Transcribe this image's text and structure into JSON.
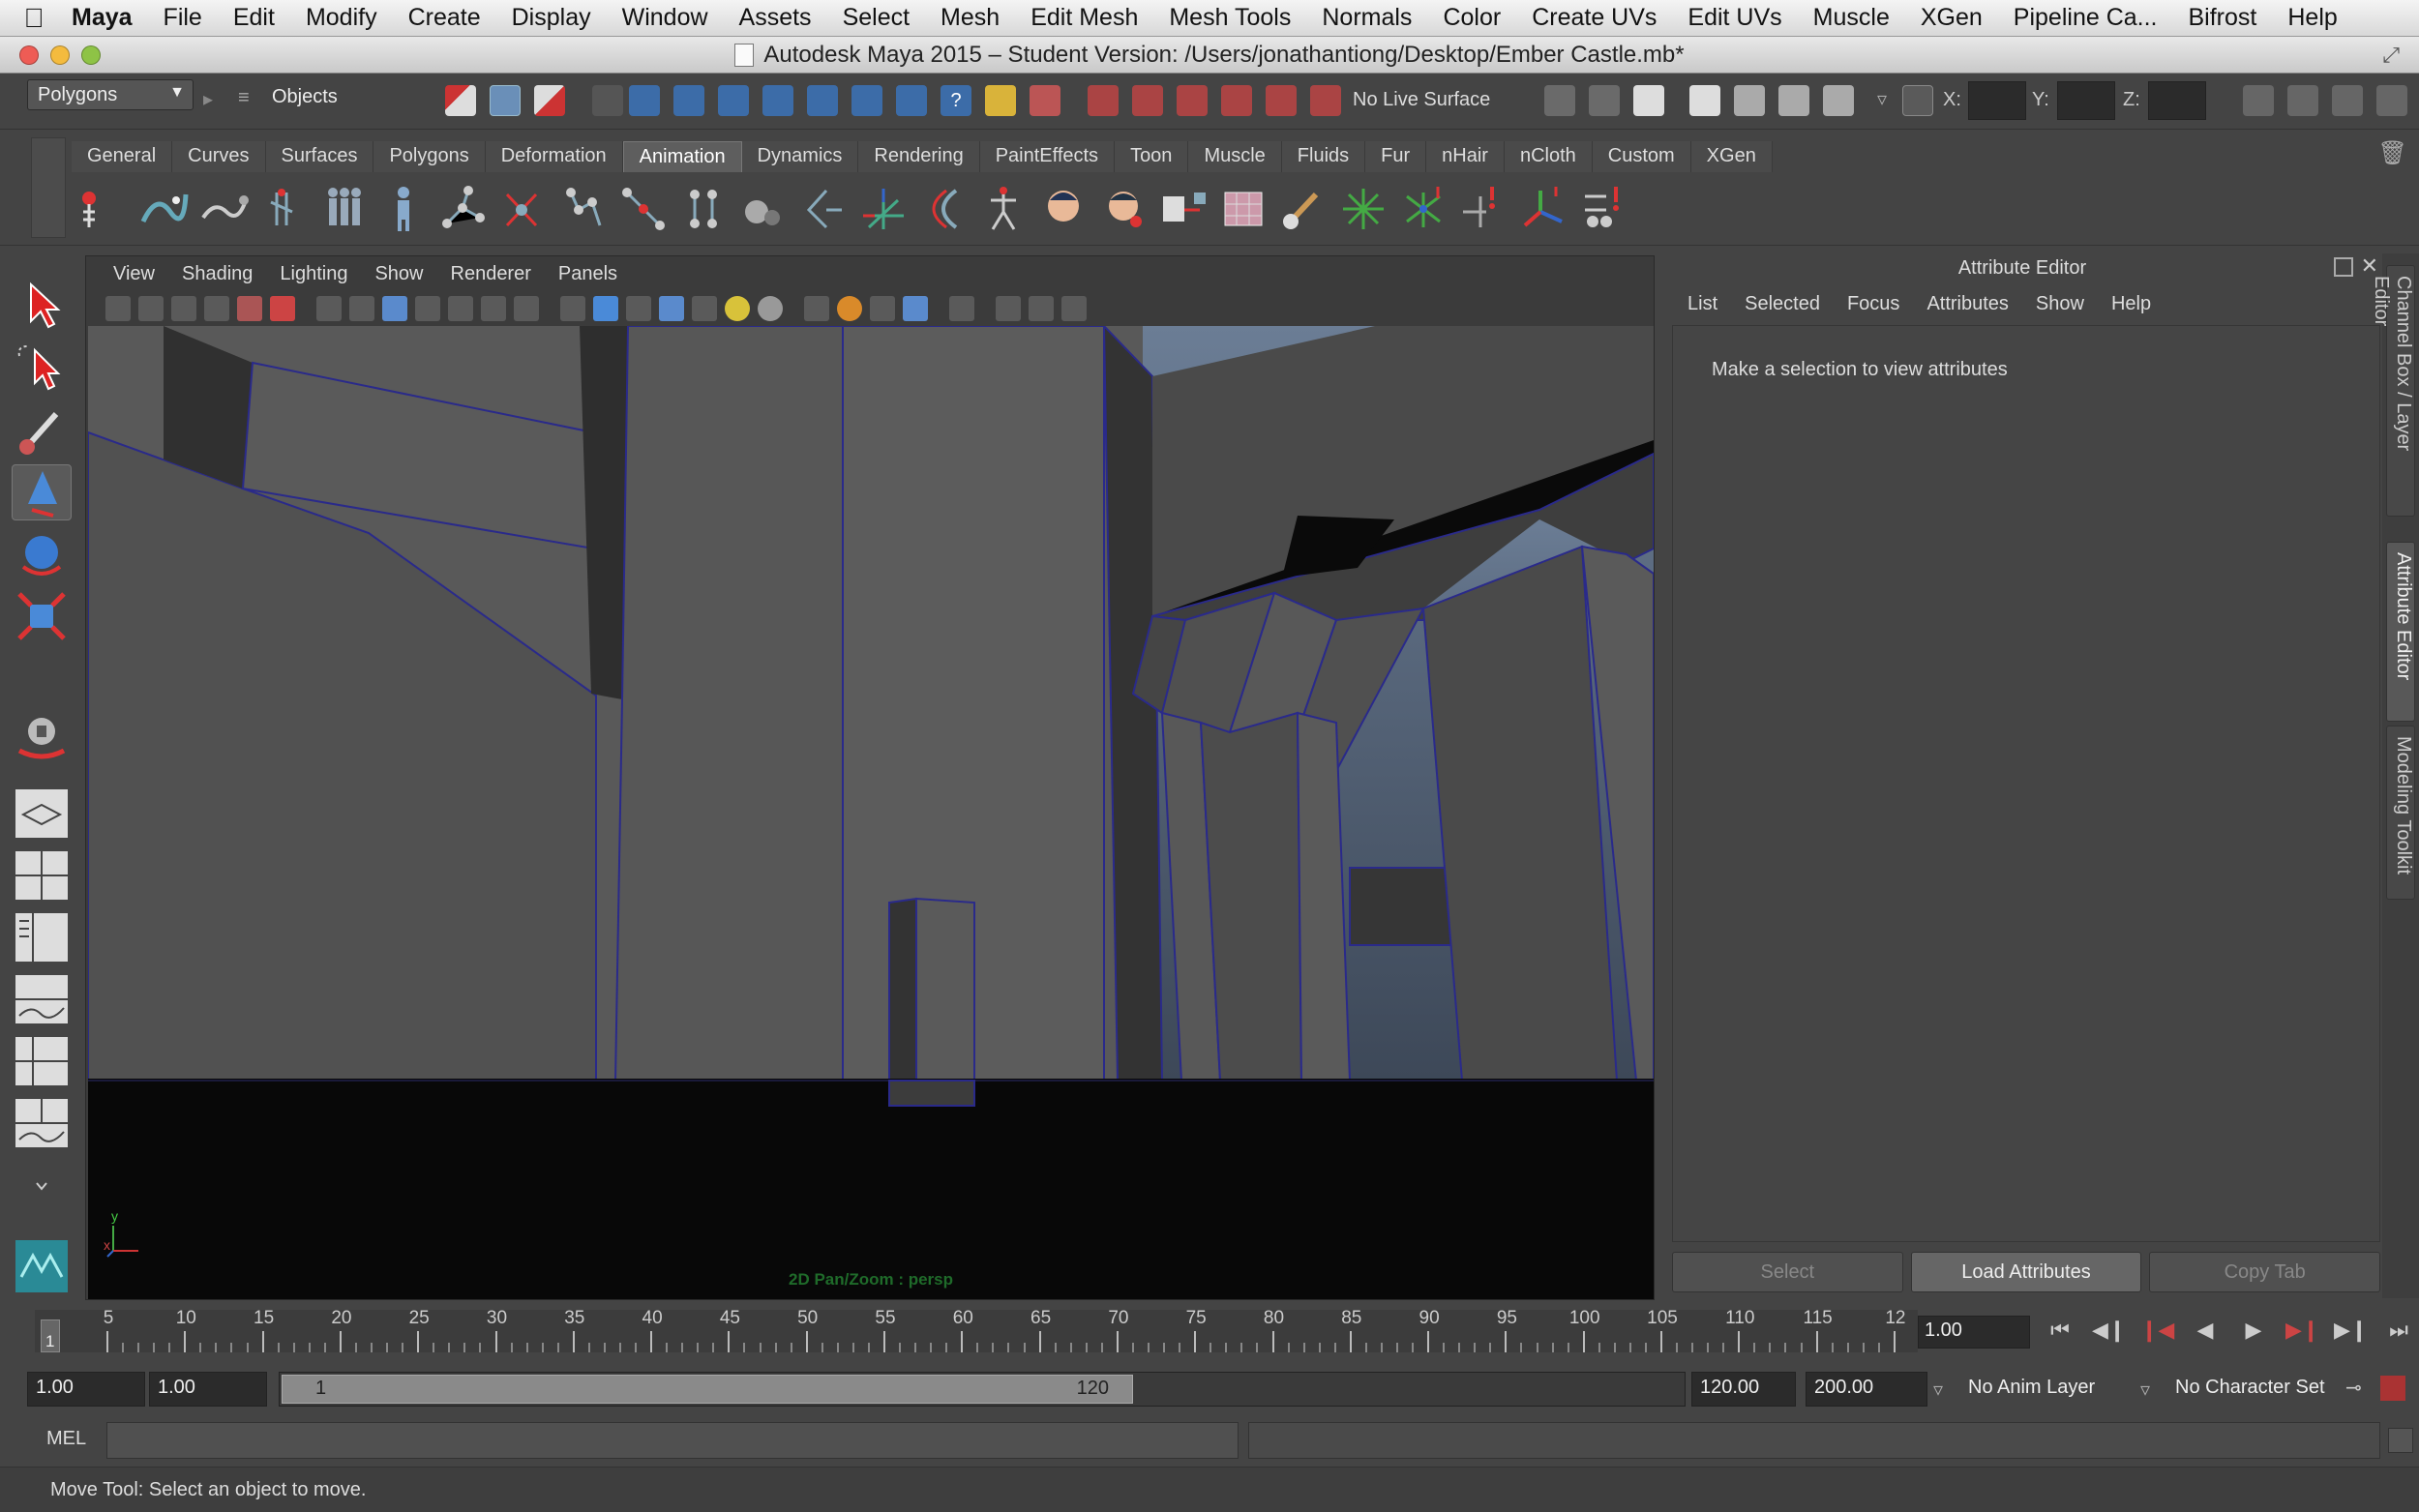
{
  "mac_menu": {
    "app": "Maya",
    "items": [
      "File",
      "Edit",
      "Modify",
      "Create",
      "Display",
      "Window",
      "Assets",
      "Select",
      "Mesh",
      "Edit Mesh",
      "Mesh Tools",
      "Normals",
      "Color",
      "Create UVs",
      "Edit UVs",
      "Muscle",
      "XGen",
      "Pipeline Ca...",
      "Bifrost",
      "Help"
    ]
  },
  "window": {
    "title": "Autodesk Maya 2015 – Student Version: /Users/jonathantiong/Desktop/Ember Castle.mb*"
  },
  "status_line": {
    "menuset": "Polygons",
    "selection_mode": "Objects",
    "live_surface": "No Live Surface",
    "x_label": "X:",
    "y_label": "Y:",
    "z_label": "Z:"
  },
  "shelf": {
    "tabs": [
      "General",
      "Curves",
      "Surfaces",
      "Polygons",
      "Deformation",
      "Animation",
      "Dynamics",
      "Rendering",
      "PaintEffects",
      "Toon",
      "Muscle",
      "Fluids",
      "Fur",
      "nHair",
      "nCloth",
      "Custom",
      "XGen"
    ],
    "active_tab": "Animation"
  },
  "viewport": {
    "menu": [
      "View",
      "Shading",
      "Lighting",
      "Show",
      "Renderer",
      "Panels"
    ],
    "hud_text": "2D Pan/Zoom : persp",
    "axis_y": "y",
    "axis_x": "x"
  },
  "attribute_editor": {
    "title": "Attribute Editor",
    "menu": [
      "List",
      "Selected",
      "Focus",
      "Attributes",
      "Show",
      "Help"
    ],
    "message": "Make a selection to view attributes",
    "buttons": {
      "select": "Select",
      "load": "Load Attributes",
      "copy": "Copy Tab"
    }
  },
  "side_tabs": [
    "Channel Box / Layer Editor",
    "Attribute Editor",
    "Modeling Toolkit"
  ],
  "time_slider": {
    "ticks": [
      5,
      10,
      15,
      20,
      25,
      30,
      35,
      40,
      45,
      50,
      55,
      60,
      65,
      70,
      75,
      80,
      85,
      90,
      95,
      100,
      105,
      110,
      115,
      12
    ],
    "current_frame": "1",
    "current_time": "1.00"
  },
  "range_slider": {
    "start": "1.00",
    "anim_start": "1.00",
    "bar_start": "1",
    "bar_end": "120",
    "end": "120.00",
    "anim_end": "200.00",
    "anim_layer": "No Anim Layer",
    "character_set": "No Character Set"
  },
  "command_line": {
    "label": "MEL"
  },
  "help_line": {
    "text": "Move Tool: Select an object to move."
  }
}
